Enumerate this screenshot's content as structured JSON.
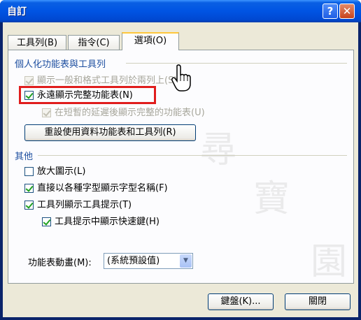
{
  "window": {
    "title": "自訂"
  },
  "tabs": [
    {
      "label": "工具列(B)",
      "active": false
    },
    {
      "label": "指令(C)",
      "active": false
    },
    {
      "label": "選項(O)",
      "active": true
    }
  ],
  "personalized": {
    "header": "個人化功能表與工具列",
    "show_on_two_rows": "顯示一般和格式工具列於兩列上(S)",
    "always_show_full_menus": "永遠顯示完整功能表(N)",
    "show_full_after_delay": "在短暫的延遲後顯示完整的功能表(U)",
    "reset_button": "重設使用資料功能表和工具列(R)"
  },
  "other": {
    "header": "其他",
    "large_icons": "放大圖示(L)",
    "list_font_names": "直接以各種字型顯示字型名稱(F)",
    "show_screentips": "工具列顯示工具提示(T)",
    "show_shortcut_keys": "工具提示中顯示快速鍵(H)",
    "menu_animation_label": "功能表動畫(M):",
    "menu_animation_value": "(系統預設值)"
  },
  "footer": {
    "keyboard_button": "鍵盤(K)...",
    "close_button": "關閉"
  },
  "watermark": [
    "尋",
    "寶",
    "園"
  ]
}
